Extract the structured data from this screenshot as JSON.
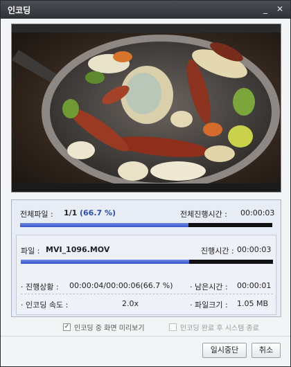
{
  "window": {
    "title": "인코딩"
  },
  "titlebar": {
    "minimize_glyph": "_",
    "close_glyph": "✕"
  },
  "overall": {
    "label": "전체파일 :",
    "count": "1/1",
    "percent": "(66.7 %)",
    "elapsed_label": "전체진행시간 :",
    "elapsed_value": "00:00:03",
    "progress": 0.667
  },
  "file": {
    "label": "파일 :",
    "name": "MVI_1096.MOV",
    "elapsed_label": "진행시간 :",
    "elapsed_value": "00:00:03",
    "progress": 0.667
  },
  "details": {
    "status_label": "· 진행상황 :",
    "status_value": "00:00:04/00:00:06(66.7 %)",
    "remaining_label": "· 남은시간 :",
    "remaining_value": "00:00:01",
    "speed_label": "· 인코딩 속도 :",
    "speed_value": "2.0x",
    "filesize_label": "· 파일크기 :",
    "filesize_value": "1.05 MB"
  },
  "options": {
    "preview_label": "인코딩 중 화면 미리보기",
    "preview_checked": "✓",
    "shutdown_label": "인코딩 완료 후 시스템 종료"
  },
  "buttons": {
    "pause_label": "일시중단",
    "cancel_label": "취소"
  },
  "colors": {
    "progress_fill": "#3454c8",
    "progress_track": "#111111",
    "accent_text": "#2b4fb0"
  }
}
